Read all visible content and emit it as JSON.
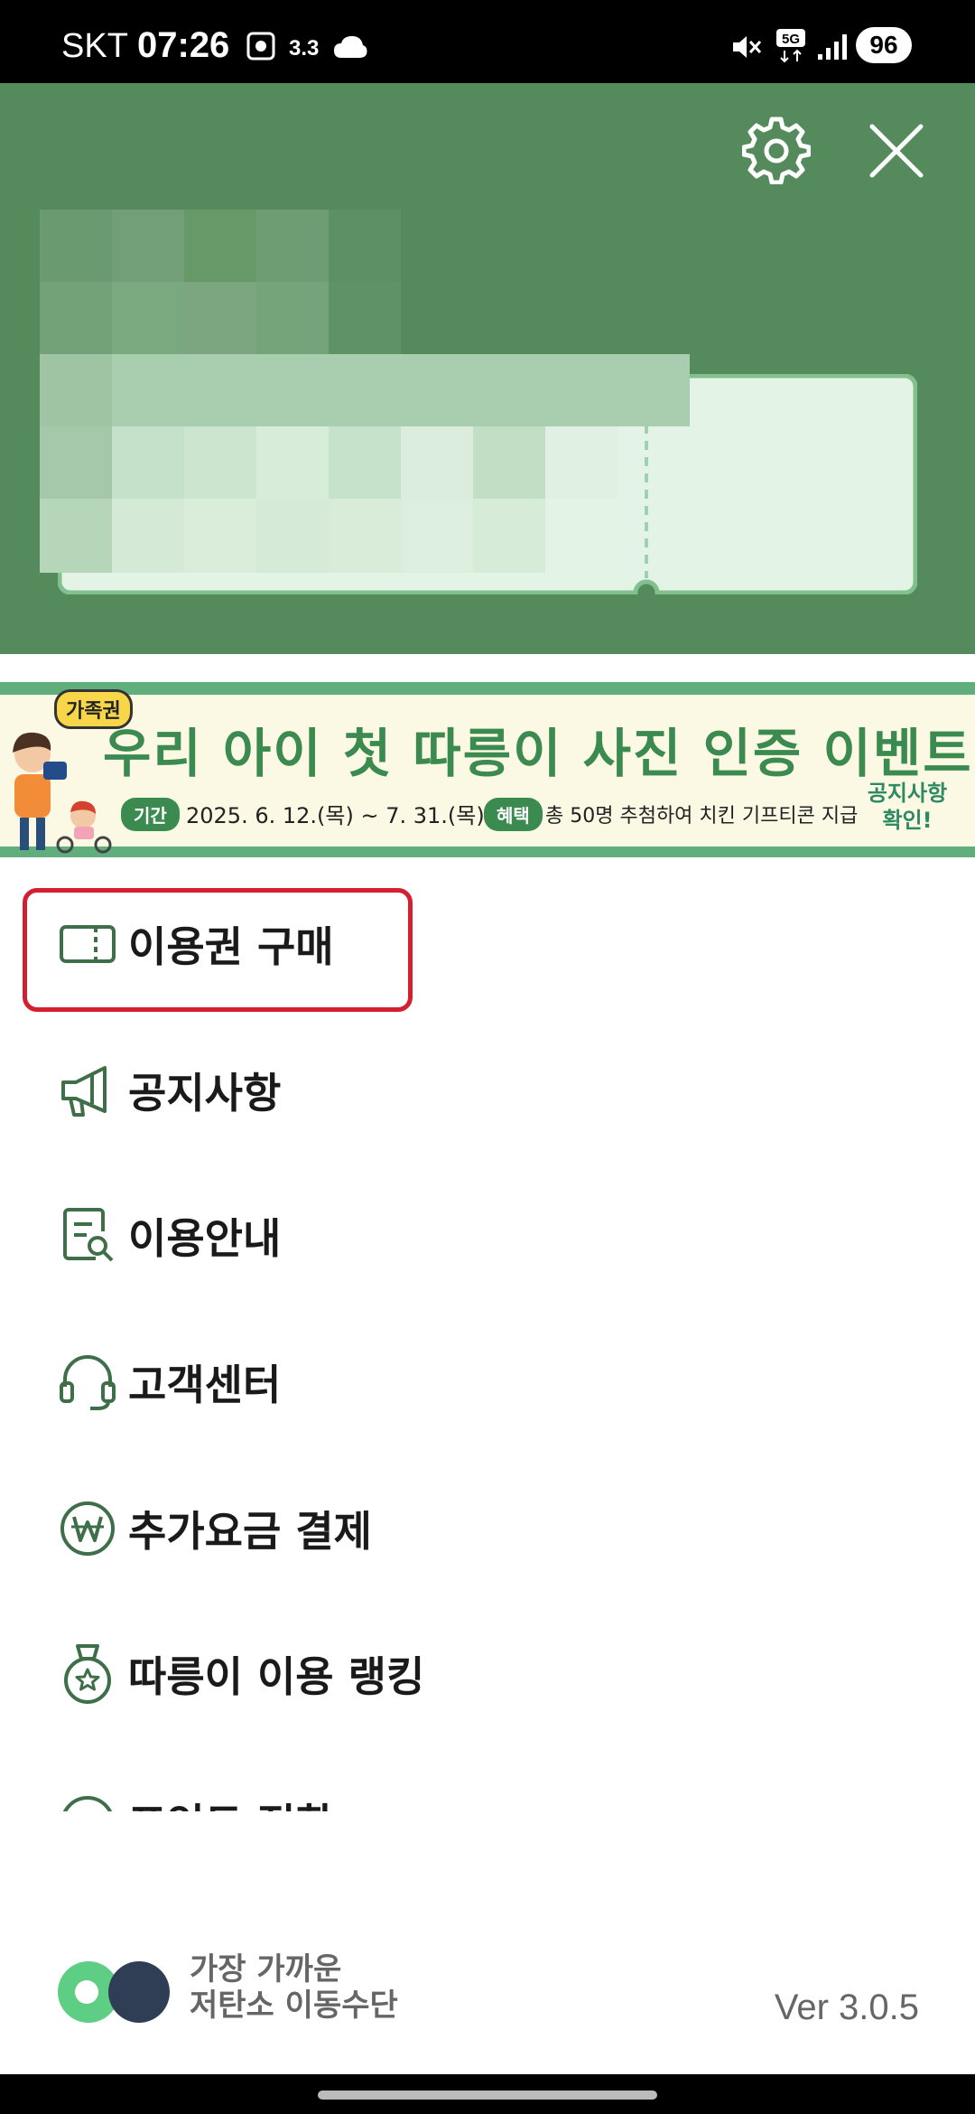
{
  "status_bar": {
    "carrier": "SKT",
    "time": "07:26",
    "network_speed": "3.3",
    "battery": "96"
  },
  "header": {
    "settings_icon": "gear-icon",
    "close_icon": "close-icon",
    "background_color": "#558a5c"
  },
  "banner": {
    "badge": "가족권",
    "title": "우리 아이 첫 따릉이 사진 인증 이벤트",
    "period_label": "기간",
    "period": "2025. 6. 12.(목) ~ 7. 31.(목)",
    "benefit_label": "혜택",
    "benefit": "총 50명 추첨하여 치킨 기프티콘 지급",
    "notice_line1": "공지사항",
    "notice_line2": "확인!"
  },
  "menu": {
    "items": [
      {
        "label": "이용권 구매",
        "icon": "ticket-icon"
      },
      {
        "label": "공지사항",
        "icon": "megaphone-icon"
      },
      {
        "label": "이용안내",
        "icon": "guide-icon"
      },
      {
        "label": "고객센터",
        "icon": "headset-icon"
      },
      {
        "label": "추가요금 결제",
        "icon": "won-icon"
      },
      {
        "label": "따릉이 이용 랭킹",
        "icon": "medal-icon"
      },
      {
        "label": "포인트 전환",
        "icon": "point-icon"
      }
    ]
  },
  "footer": {
    "slogan_line1": "가장 가까운",
    "slogan_line2": "저탄소 이동수단",
    "version": "Ver 3.0.5"
  },
  "colors": {
    "accent": "#3b8a50",
    "highlight": "#d31f2f"
  }
}
